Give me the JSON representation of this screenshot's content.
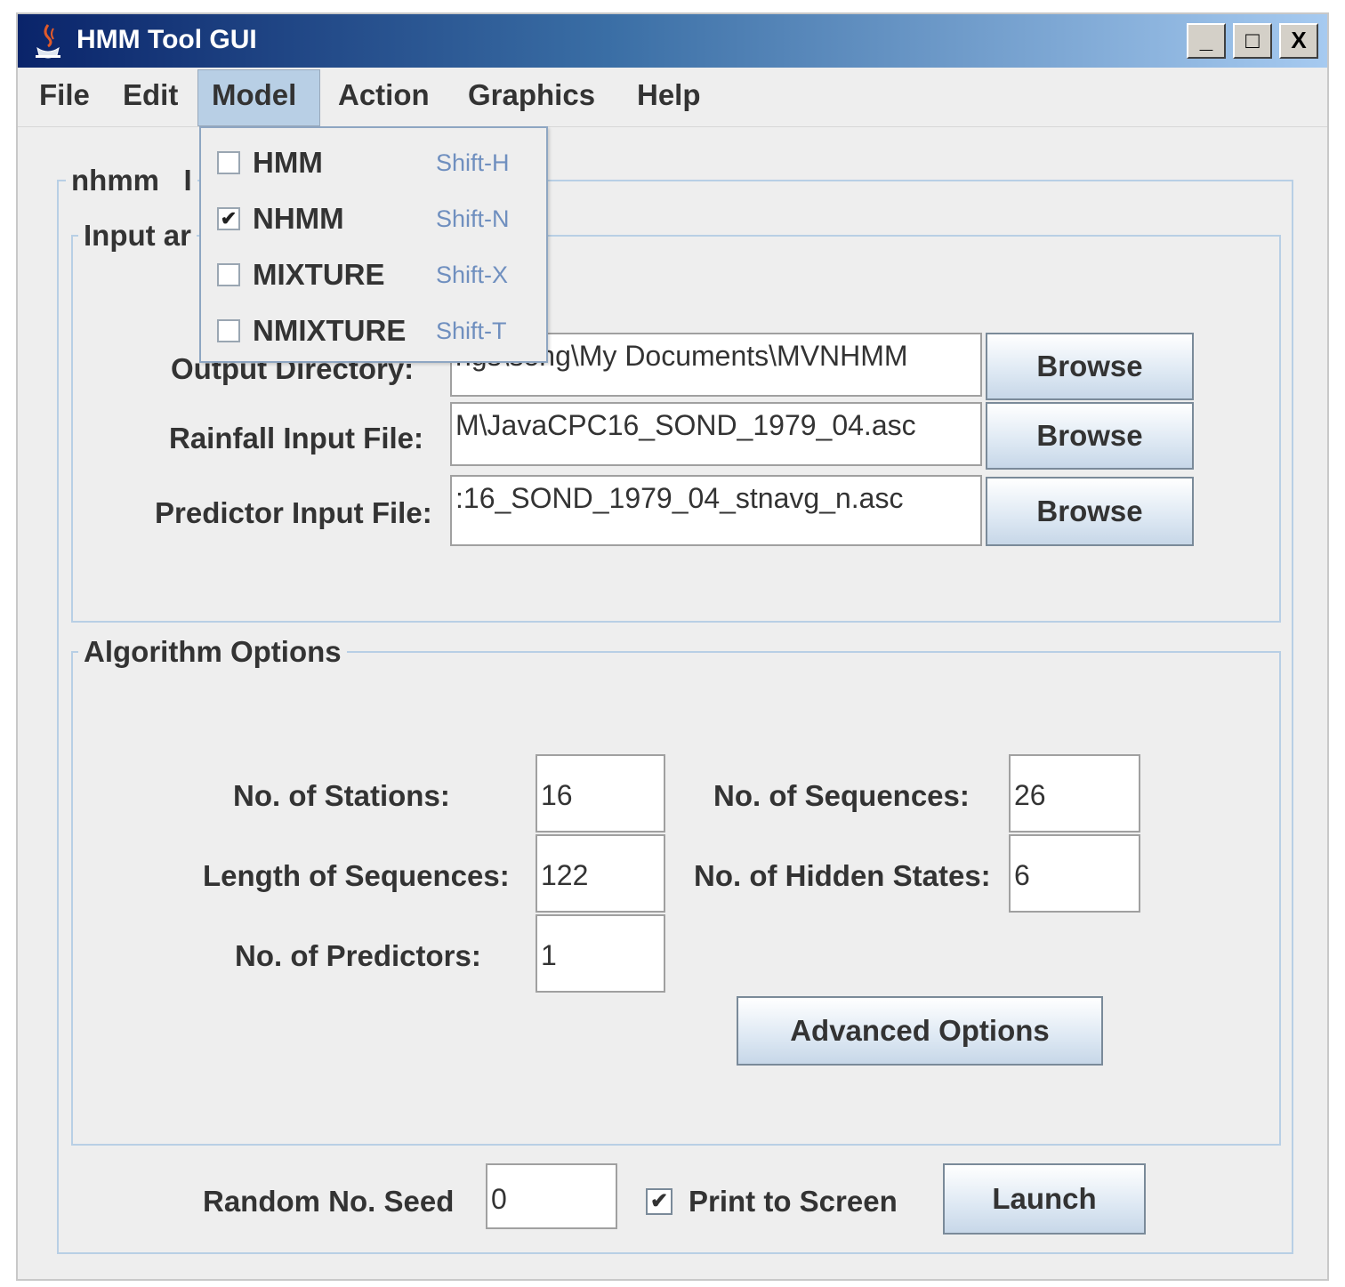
{
  "window": {
    "title": "HMM Tool GUI",
    "controls": [
      "_",
      "□",
      "X"
    ]
  },
  "menubar": {
    "items": [
      "File",
      "Edit",
      "Model",
      "Action",
      "Graphics",
      "Help"
    ],
    "active": "Model"
  },
  "model_menu": {
    "items": [
      {
        "label": "HMM",
        "shortcut": "Shift-H",
        "checked": false
      },
      {
        "label": "NHMM",
        "shortcut": "Shift-N",
        "checked": true
      },
      {
        "label": "MIXTURE",
        "shortcut": "Shift-X",
        "checked": false
      },
      {
        "label": "NMIXTURE",
        "shortcut": "Shift-T",
        "checked": false
      }
    ]
  },
  "panel": {
    "title": "nhmm",
    "title_suffix": "I"
  },
  "input_group": {
    "title": "Input ar",
    "rows": [
      {
        "label": "Output Directory:",
        "value": "ngs\\song\\My Documents\\MVNHMM",
        "button": "Browse"
      },
      {
        "label": "Rainfall Input File:",
        "value": "M\\JavaCPC16_SOND_1979_04.asc",
        "button": "Browse"
      },
      {
        "label": "Predictor Input File:",
        "value": ":16_SOND_1979_04_stnavg_n.asc",
        "button": "Browse"
      }
    ]
  },
  "algorithm_group": {
    "title": "Algorithm Options",
    "stations_label": "No. of Stations:",
    "stations_value": "16",
    "sequences_label": "No. of Sequences:",
    "sequences_value": "26",
    "length_label": "Length of Sequences:",
    "length_value": "122",
    "hidden_label": "No. of Hidden States:",
    "hidden_value": "6",
    "predictors_label": "No. of Predictors:",
    "predictors_value": "1",
    "advanced_button": "Advanced Options"
  },
  "bottom": {
    "seed_label": "Random No. Seed",
    "seed_value": "0",
    "print_label": "Print to Screen",
    "print_checked": true,
    "launch_button": "Launch"
  },
  "colors": {
    "title_start": "#0a246a",
    "title_end": "#a6caf0",
    "border": "#b8cfe5",
    "menu_highlight": "#b8cfe5"
  }
}
